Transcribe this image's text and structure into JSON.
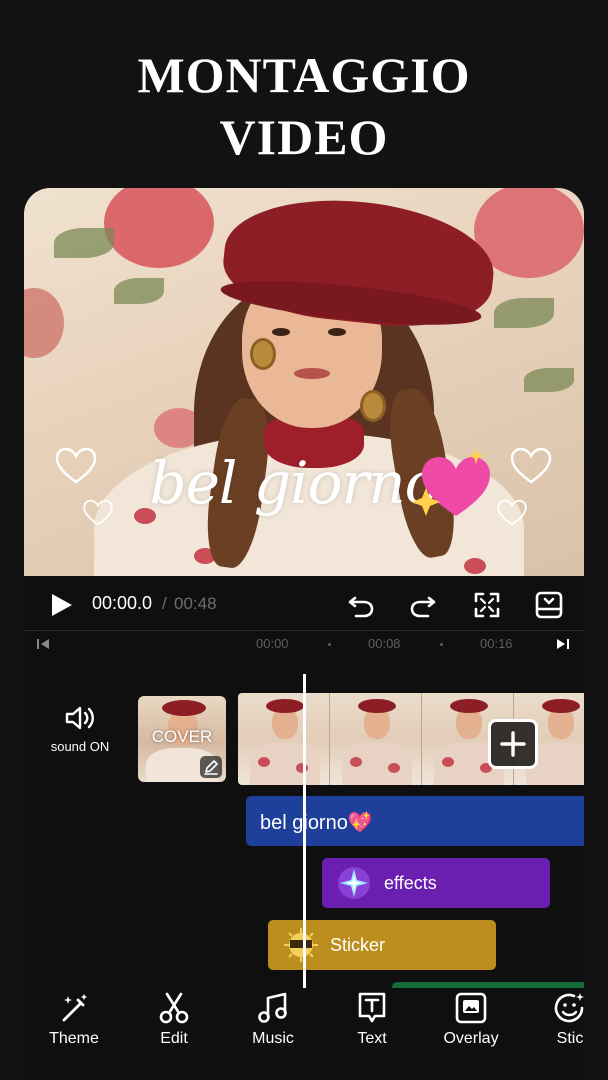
{
  "headline": {
    "line1": "MONTAGGIO",
    "line2": "VIDEO"
  },
  "preview": {
    "overlay_text": "bel giorno"
  },
  "playback": {
    "current_time": "00:00.0",
    "separator": "/",
    "total_time": "00:48",
    "icons": [
      "play-icon",
      "undo-icon",
      "redo-icon",
      "fullscreen-icon",
      "keyframe-icon"
    ]
  },
  "ruler": {
    "ticks": [
      "00:00",
      "00:08",
      "00:16"
    ]
  },
  "timeline": {
    "sound_label": "sound ON",
    "cover_label": "COVER",
    "tracks": {
      "text": "bel giorno💖",
      "effects": "effects",
      "sticker": "Sticker"
    }
  },
  "toolbar": {
    "items": [
      {
        "label": "Theme",
        "icon": "magic-wand-icon"
      },
      {
        "label": "Edit",
        "icon": "scissors-icon"
      },
      {
        "label": "Music",
        "icon": "music-note-icon"
      },
      {
        "label": "Text",
        "icon": "text-icon"
      },
      {
        "label": "Overlay",
        "icon": "overlay-icon"
      },
      {
        "label": "Stic",
        "icon": "sticker-icon"
      }
    ]
  },
  "colors": {
    "background": "#121212",
    "text_track": "#1e3f9a",
    "effects_track": "#6a1fb0",
    "sticker_track": "#bb8e1e",
    "extra_track": "#146b3a"
  }
}
